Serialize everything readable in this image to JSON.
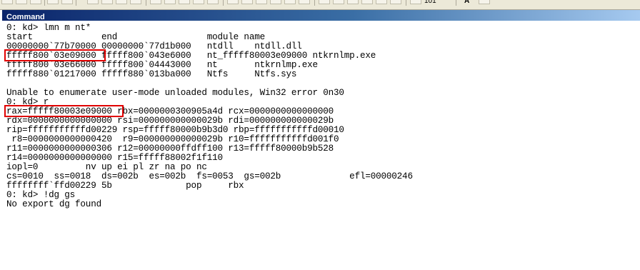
{
  "toolbar": {
    "font_size_label": "101",
    "font_glyph": "A"
  },
  "window": {
    "title": "Command"
  },
  "colors": {
    "highlight": "#e00000",
    "title_bar_start": "#0a246a",
    "title_bar_end": "#a6caf0"
  },
  "output": {
    "lines": [
      "0: kd> lmn m nt*",
      "start             end                 module name",
      "00000000`77b70000 00000000`77d1b000   ntdll    ntdll.dll",
      "fffff800`03e09000 fffff800`043e6000   nt_fffff80003e09000 ntkrnlmp.exe",
      "fffff800`03e66000 fffff800`04443000   nt       ntkrnlmp.exe",
      "fffff880`01217000 fffff880`013ba000   Ntfs     Ntfs.sys",
      "",
      "Unable to enumerate user-mode unloaded modules, Win32 error 0n30",
      "0: kd> r",
      "rax=fffff80003e09000 rbx=0000000300905a4d rcx=0000000000000000",
      "rdx=0000000000000000 rsi=000000000000029b rdi=000000000000029b",
      "rip=fffffffffffd00229 rsp=fffff80000b9b3d0 rbp=fffffffffffd00010",
      " r8=0000000000000420  r9=000000000000029b r10=fffffffffffd001f0",
      "r11=0000000000000306 r12=00000000ffdff100 r13=fffff80000b9b528",
      "r14=0000000000000000 r15=fffff88002f1f110",
      "iopl=0         nv up ei pl zr na po nc",
      "cs=0010  ss=0018  ds=002b  es=002b  fs=0053  gs=002b             efl=00000246",
      "ffffffff`ffd00229 5b              pop     rbx",
      "0: kd> !dg gs",
      "No export dg found"
    ]
  }
}
